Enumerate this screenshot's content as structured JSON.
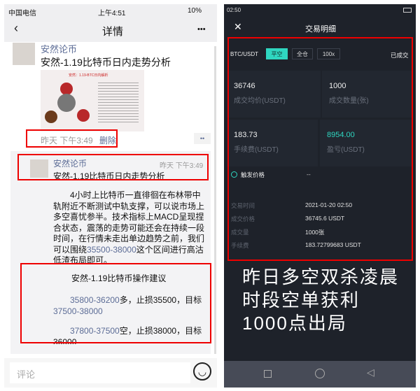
{
  "left": {
    "status": {
      "carrier": "中国电信",
      "time": "上午4:51",
      "battery": "10%"
    },
    "nav": {
      "title": "详情",
      "back_icon": "chevron-left-icon",
      "more_icon": "more-icon",
      "more_label": "•••"
    },
    "post": {
      "author": "安然论币",
      "title": "安然-1.19比特币日内走势分析",
      "image_caption": "安然：1.19-BTC日内解析",
      "time": "昨天 下午3:49",
      "delete_label": "删除",
      "dots_label": "••"
    },
    "comment": {
      "author": "安然论币",
      "time": "昨天 下午3:49",
      "title": "安然-1.19比特币日内走势分析",
      "body_pre": "4小时上比特币一直徘徊在布林带中轨附近不断测试中轨支撑，可以说市场上多空喜忧参半。技术指标上MACD呈现捏合状态，震荡的走势可能还会在持续一段时间，在行情未走出单边趋势之前，我们可以围绕",
      "body_link": "35500-38000",
      "body_post": "这个区间进行高沽低渣布局即可。",
      "advice_title": "安然-1.19比特币操作建议",
      "advice1_link": "35800-36200",
      "advice1_text": "多，止损35500，目标",
      "advice1_target": "37500-38000",
      "advice2_link": "37800-37500",
      "advice2_text": "空，止损38000，目标36000"
    },
    "input": {
      "placeholder": "评论",
      "emoji_icon": "emoji-icon"
    }
  },
  "right": {
    "status": {
      "time": "02:50"
    },
    "header": {
      "title": "交易明细",
      "close_icon": "close-icon"
    },
    "pair": "BTC/USDT",
    "tags": [
      "平空",
      "全仓",
      "100x"
    ],
    "state": "已成交",
    "cells": [
      {
        "value": "36746",
        "label": "成交均价(USDT)"
      },
      {
        "value": "1000",
        "label": "成交数量(张)"
      },
      {
        "value": "183.73",
        "label": "手续费(USDT)"
      },
      {
        "value": "8954.00",
        "label": "盈亏(USDT)"
      }
    ],
    "trigger": {
      "label": "触发价格",
      "value": "--"
    },
    "details": [
      {
        "key": "交易时间",
        "value": "2021-01-20 02:50"
      },
      {
        "key": "成交价格",
        "value": "36745.6 USDT"
      },
      {
        "key": "成交量",
        "value": "1000张"
      },
      {
        "key": "手续费",
        "value": "183.72799683 USDT"
      }
    ],
    "caption": "昨日多空双杀凌晨时段空单获利1000点出局",
    "colors": {
      "accent": "#2fd6c0",
      "profit": "#2fd6c0",
      "highlight": "#e00000"
    }
  }
}
